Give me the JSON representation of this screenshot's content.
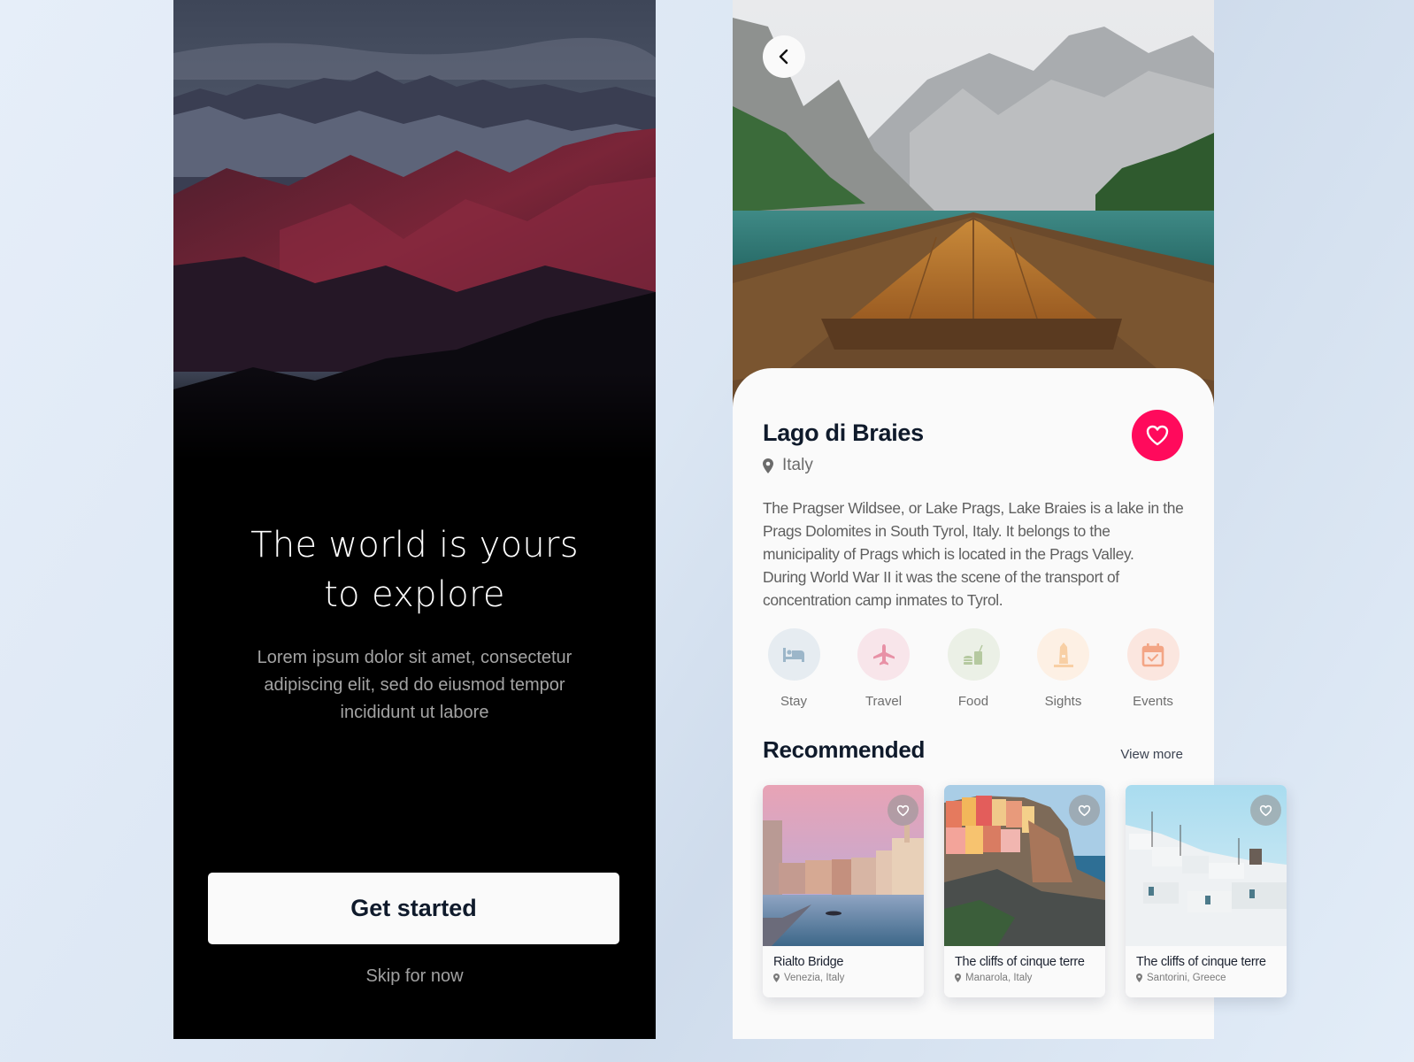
{
  "onboarding": {
    "title_lines": [
      "The world is yours",
      "to explore"
    ],
    "subtitle_lines": [
      "Lorem ipsum dolor sit amet, consectetur",
      "adipiscing elit, sed do eiusmod tempor",
      "incididunt ut labore"
    ],
    "primary_button": "Get started",
    "skip_link": "Skip for now"
  },
  "detail": {
    "back_icon": "chevron-left-icon",
    "title": "Lago di Braies",
    "location": "Italy",
    "favorite_icon": "heart-icon",
    "description_lines": [
      "The Pragser Wildsee, or Lake Prags, Lake Braies is a lake in the",
      "Prags Dolomites in South Tyrol, Italy. It belongs to the",
      "municipality of Prags which is located in the Prags Valley.",
      "During World War II it was the scene of the transport of",
      "concentration camp inmates to Tyrol."
    ],
    "categories": [
      {
        "label": "Stay",
        "icon": "bed-icon",
        "bg": "#e6ecf1",
        "fg": "#9cb6c9"
      },
      {
        "label": "Travel",
        "icon": "airplane-icon",
        "bg": "#f8e5ea",
        "fg": "#e891a6"
      },
      {
        "label": "Food",
        "icon": "food-drink-icon",
        "bg": "#ebf0e6",
        "fg": "#b5c9a0"
      },
      {
        "label": "Sights",
        "icon": "monument-icon",
        "bg": "#fdf0e4",
        "fg": "#f8cfa4"
      },
      {
        "label": "Events",
        "icon": "calendar-check-icon",
        "bg": "#fbe6df",
        "fg": "#f3a585"
      }
    ],
    "recommended": {
      "title": "Recommended",
      "view_more": "View more",
      "items": [
        {
          "name": "Rialto Bridge",
          "location": "Venezia, Italy"
        },
        {
          "name": "The cliffs of cinque terre",
          "location": "Manarola, Italy"
        },
        {
          "name": "The cliffs of cinque terre",
          "location": "Santorini, Greece"
        }
      ]
    }
  },
  "colors": {
    "accent": "#ff0a5c",
    "heading": "#0f1a2b",
    "onboarding_bg": "#000000",
    "sheet_bg": "#fafafa"
  }
}
